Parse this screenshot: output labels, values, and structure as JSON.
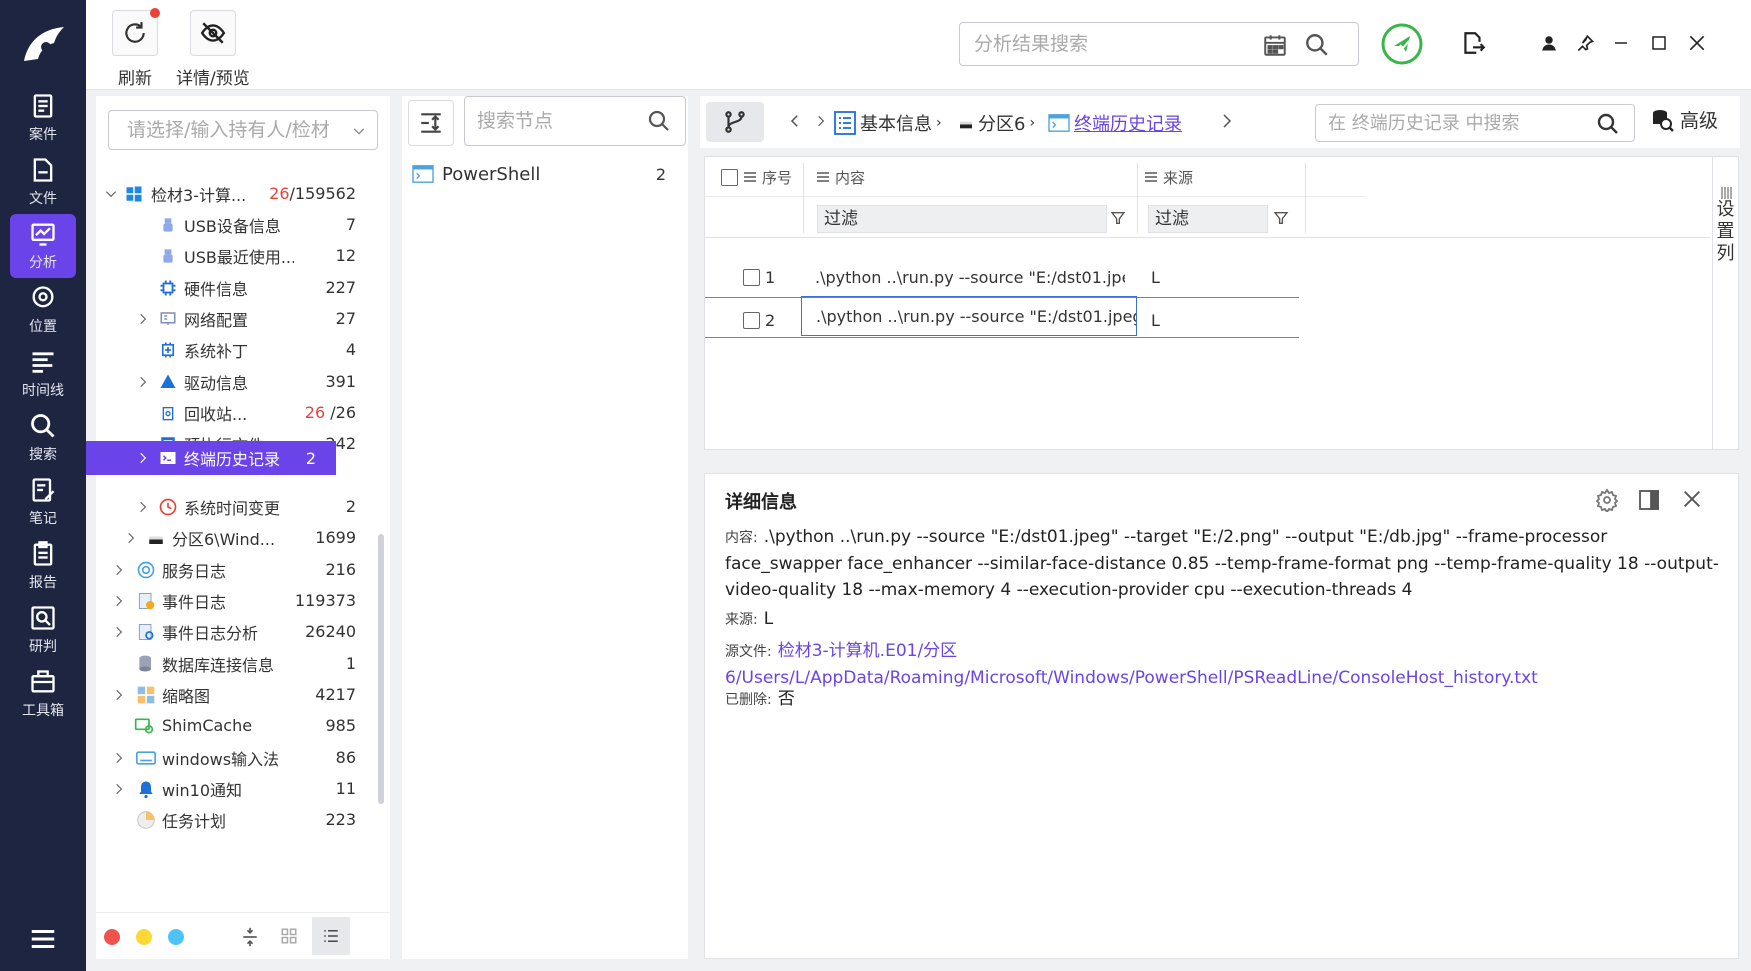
{
  "rail": {
    "items": [
      {
        "label": "案件",
        "icon": "case-icon"
      },
      {
        "label": "文件",
        "icon": "file-icon"
      },
      {
        "label": "分析",
        "icon": "analysis-icon"
      },
      {
        "label": "位置",
        "icon": "location-icon"
      },
      {
        "label": "时间线",
        "icon": "timeline-icon"
      },
      {
        "label": "搜索",
        "icon": "search-icon"
      },
      {
        "label": "笔记",
        "icon": "note-icon"
      },
      {
        "label": "报告",
        "icon": "report-icon"
      },
      {
        "label": "研判",
        "icon": "judge-icon"
      },
      {
        "label": "工具箱",
        "icon": "toolbox-icon"
      }
    ],
    "active_color": "#6a44e8"
  },
  "toolbar": {
    "refresh_label": "刷新",
    "detail_label": "详情/预览",
    "search_placeholder": "分析结果搜索"
  },
  "tree": {
    "holder_placeholder": "请选择/输入持有人/检材",
    "root": {
      "label": "检材3-计算...",
      "count_red": "26",
      "count_rest": "/159562"
    },
    "items": [
      {
        "label": "USB设备信息",
        "count": "7"
      },
      {
        "label": "USB最近使用...",
        "count": "12"
      },
      {
        "label": "硬件信息",
        "count": "227"
      },
      {
        "label": "网络配置",
        "count": "27"
      },
      {
        "label": "系统补丁",
        "count": "4"
      },
      {
        "label": "驱动信息",
        "count": "391"
      },
      {
        "label": "回收站...",
        "count_red": "26",
        "count_rest": " /26"
      },
      {
        "label": "预执行文件",
        "count": "242"
      },
      {
        "label": "终端历史记录",
        "count": "2"
      },
      {
        "label": "系统时间变更",
        "count": "2"
      },
      {
        "label": "分区6\\Wind...",
        "count": "1699"
      },
      {
        "label": "服务日志",
        "count": "216"
      },
      {
        "label": "事件日志",
        "count": "119373"
      },
      {
        "label": "事件日志分析",
        "count": "26240"
      },
      {
        "label": "数据库连接信息",
        "count": "1"
      },
      {
        "label": "缩略图",
        "count": "4217"
      },
      {
        "label": "ShimCache",
        "count": "985"
      },
      {
        "label": "windows输入法",
        "count": "86"
      },
      {
        "label": "win10通知",
        "count": "11"
      },
      {
        "label": "任务计划",
        "count": "223"
      }
    ]
  },
  "nodes": {
    "search_placeholder": "搜索节点",
    "items": [
      {
        "label": "PowerShell",
        "count": "2"
      }
    ]
  },
  "breadcrumb": {
    "items": [
      "基本信息",
      "分区6",
      "终端历史记录"
    ],
    "search_placeholder": "在 终端历史记录 中搜索",
    "advanced_label": "高级"
  },
  "grid": {
    "headers": {
      "seq": "序号",
      "content": "内容",
      "source": "来源"
    },
    "filter_label": "过滤",
    "settings_label": [
      "设",
      "置",
      "列"
    ],
    "rows": [
      {
        "seq": "1",
        "content": ".\\python ..\\run.py --source \"E:/dst01.jpeg\" ...",
        "source": "L"
      },
      {
        "seq": "2",
        "content": ".\\python ..\\run.py --source \"E:/dst01.jpeg\" ...",
        "source": "L"
      }
    ]
  },
  "detail": {
    "title": "详细信息",
    "content_key": "内容:",
    "content_value": ".\\python ..\\run.py --source \"E:/dst01.jpeg\" --target \"E:/2.png\" --output \"E:/db.jpg\" --frame-processor face_swapper face_enhancer --similar-face-distance 0.85 --temp-frame-format png --temp-frame-quality 18 --output-video-quality 18 --max-memory 4 --execution-provider cpu --execution-threads 4",
    "source_key": "来源:",
    "source_value": "L",
    "file_key": "源文件:",
    "file_value": "检材3-计算机.E01/分区6/Users/L/AppData/Roaming/Microsoft/Windows/PowerShell/PSReadLine/ConsoleHost_history.txt",
    "deleted_key": "已删除:",
    "deleted_value": "否"
  }
}
